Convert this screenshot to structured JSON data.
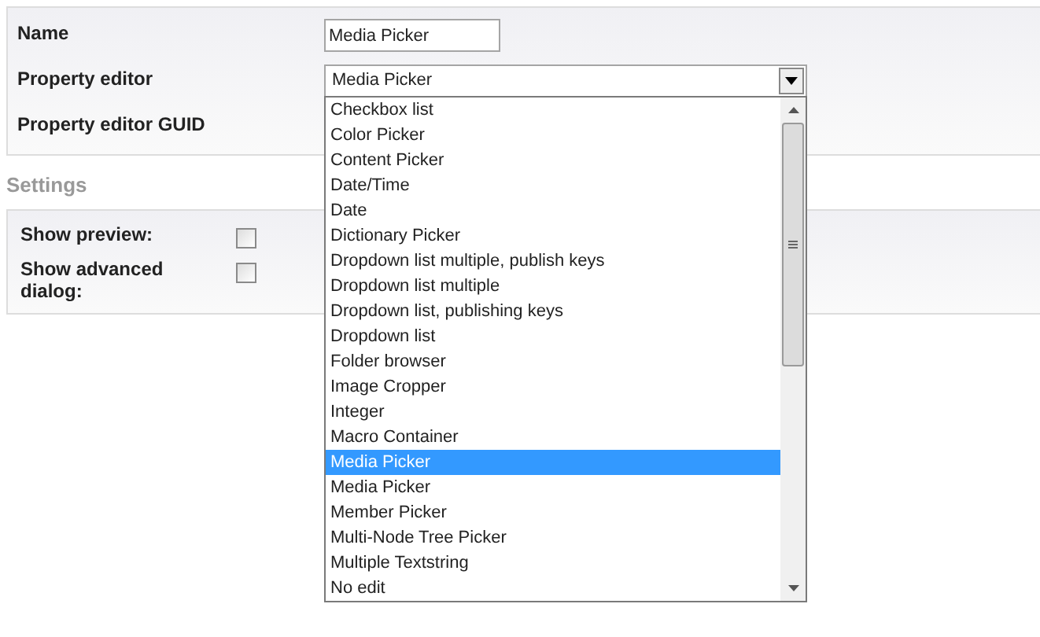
{
  "properties": {
    "rows": [
      {
        "label": "Name",
        "kind": "text",
        "value": "Media Picker"
      },
      {
        "label": "Property editor",
        "kind": "select",
        "value": "Media Picker"
      },
      {
        "label": "Property editor GUID",
        "kind": "none"
      }
    ]
  },
  "settings": {
    "heading": "Settings",
    "rows": [
      {
        "label": "Show preview:",
        "checked": false
      },
      {
        "label": "Show advanced dialog:",
        "checked": false
      }
    ]
  },
  "dropdown": {
    "expanded": true,
    "options": [
      {
        "label": "Checkbox list",
        "selected": false
      },
      {
        "label": "Color Picker",
        "selected": false
      },
      {
        "label": "Content Picker",
        "selected": false
      },
      {
        "label": "Date/Time",
        "selected": false
      },
      {
        "label": "Date",
        "selected": false
      },
      {
        "label": "Dictionary Picker",
        "selected": false
      },
      {
        "label": "Dropdown list multiple, publish keys",
        "selected": false
      },
      {
        "label": "Dropdown list multiple",
        "selected": false
      },
      {
        "label": "Dropdown list, publishing keys",
        "selected": false
      },
      {
        "label": "Dropdown list",
        "selected": false
      },
      {
        "label": "Folder browser",
        "selected": false
      },
      {
        "label": "Image Cropper",
        "selected": false
      },
      {
        "label": "Integer",
        "selected": false
      },
      {
        "label": "Macro Container",
        "selected": false
      },
      {
        "label": "Media Picker",
        "selected": true
      },
      {
        "label": "Media Picker",
        "selected": false
      },
      {
        "label": "Member Picker",
        "selected": false
      },
      {
        "label": "Multi-Node Tree Picker",
        "selected": false
      },
      {
        "label": "Multiple Textstring",
        "selected": false
      },
      {
        "label": "No edit",
        "selected": false
      }
    ]
  }
}
